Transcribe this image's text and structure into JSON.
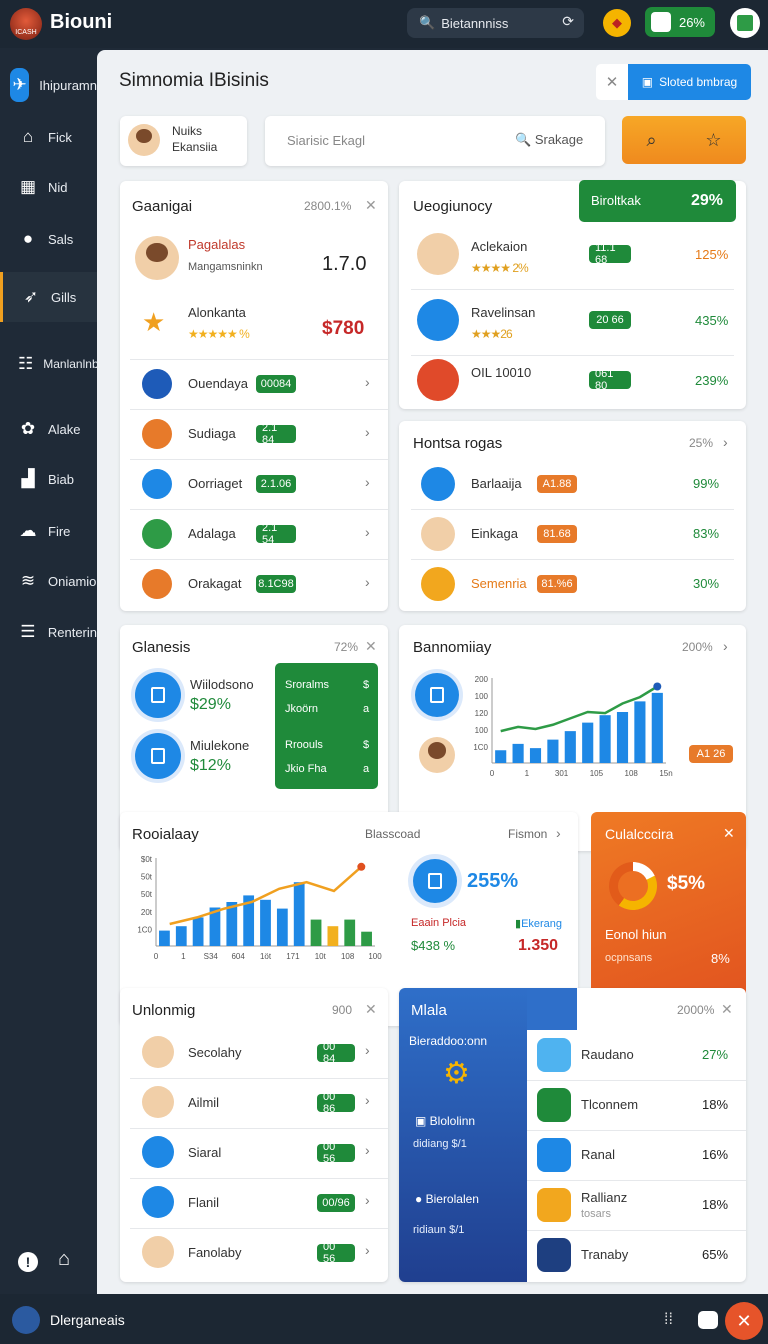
{
  "topbar": {
    "logo_text": "ICASH",
    "brand": "Biouni",
    "search_text": "Bietannniss",
    "pill_text": "26%"
  },
  "sidebar": {
    "items": [
      {
        "label": "Ihipuramn",
        "icon": "plane-icon"
      },
      {
        "label": "Fick",
        "icon": "home-icon"
      },
      {
        "label": "Nid",
        "icon": "building-icon"
      },
      {
        "label": "Sals",
        "icon": "pin-icon"
      },
      {
        "label": "Gills",
        "icon": "bird-icon"
      },
      {
        "label": "Manlanlnb",
        "icon": "table-icon"
      },
      {
        "label": "Alake",
        "icon": "puzzle-icon"
      },
      {
        "label": "Biab",
        "icon": "chart-icon"
      },
      {
        "label": "Fire",
        "icon": "chat-icon"
      },
      {
        "label": "Oniamio",
        "icon": "wifi-icon"
      },
      {
        "label": "Renterin",
        "icon": "list-icon"
      }
    ]
  },
  "bottombar": {
    "label": "Dlerganeais"
  },
  "header": {
    "title": "Simnomia IBisinis",
    "close": "✕",
    "primary_button": "Sloted bmbrag"
  },
  "profile": {
    "name": "Nuiks",
    "sub": "Ekansiia"
  },
  "search": {
    "placeholder": "Siarisic Ekagl",
    "button_label": "Srakage"
  },
  "card_a": {
    "title": "Gaanigai",
    "meta": "2800.1%",
    "top": [
      {
        "name": "Pagalalas",
        "sub": "Mangamsninkn",
        "value": "1.7.0"
      },
      {
        "name": "Alonkanta",
        "sub": "★★★★★ %",
        "value": "$780"
      }
    ],
    "rows": [
      {
        "label": "Ouendaya",
        "badge": "00084"
      },
      {
        "label": "Sudiaga",
        "badge": "2.1 84"
      },
      {
        "label": "Oorriaget",
        "badge": "2.1.06"
      },
      {
        "label": "Adalaga",
        "badge": "2.1 54"
      },
      {
        "label": "Orakagat",
        "badge": "8.1C98"
      }
    ]
  },
  "card_b": {
    "title": "Ueogiunocy",
    "green_label": "Biroltkak",
    "green_pct": "29%",
    "rows": [
      {
        "name": "Aclekaion",
        "sub": "★★★★ 2%",
        "badge": "11.1 68",
        "pct": "125%"
      },
      {
        "name": "Ravelinsan",
        "sub": "★★★26",
        "badge": "20 66",
        "pct": "435%"
      },
      {
        "name": "OIL 10010",
        "sub": "",
        "badge": "061 80",
        "pct": "239%"
      }
    ]
  },
  "card_c": {
    "title": "Hontsa rogas",
    "meta": "25%",
    "rows": [
      {
        "name": "Barlaaija",
        "badge": "A1.88",
        "pct": "99%"
      },
      {
        "name": "Einkaga",
        "badge": "81.68",
        "pct": "83%"
      },
      {
        "name": "Semenria",
        "badge": "81.%6",
        "pct": "30%"
      }
    ]
  },
  "card_d": {
    "title": "Glanesis",
    "meta": "72%",
    "items": [
      {
        "name": "Wiilodsono",
        "value": "$29%"
      },
      {
        "name": "Miulekone",
        "value": "$12%"
      }
    ],
    "panel": [
      {
        "label": "Sroralms",
        "value": "$"
      },
      {
        "label": "Jkoörn",
        "value": "a"
      },
      {
        "label": "Rroouls",
        "value": "$"
      },
      {
        "label": "Jkio Fha",
        "value": "a"
      }
    ]
  },
  "card_e": {
    "title": "Bannomiiay",
    "meta": "200%",
    "badge": "A1 26"
  },
  "card_f": {
    "title": "Rooialaay",
    "center_label": "Blasscoad",
    "right_label": "Fismon",
    "stat_big": "255%",
    "left_stat_label": "Eaain Plcia",
    "left_stat_value": "$438 %",
    "right_stat_label": "Ekerang",
    "right_stat_value": "1.350"
  },
  "card_g": {
    "title": "Culalcccira",
    "pct": "$5%",
    "label": "Eonol hiun",
    "sub": "ocpnsans",
    "sub_pct": "8%"
  },
  "card_h": {
    "title": "Unlonmig",
    "meta": "900",
    "rows": [
      {
        "label": "Secolahy",
        "badge": "00 84"
      },
      {
        "label": "Ailmil",
        "badge": "00 86"
      },
      {
        "label": "Siaral",
        "badge": "00 56"
      },
      {
        "label": "Flanil",
        "badge": "00/96"
      },
      {
        "label": "Fanolaby",
        "badge": "00 56"
      }
    ]
  },
  "card_i": {
    "title": "Mlala",
    "meta": "2000%",
    "subtitle": "Bieraddoo:onn",
    "items": [
      {
        "name": "Blololinn",
        "sub": "didiang $/1"
      },
      {
        "name": "Bierolalen",
        "sub": "ridiaun $/1"
      }
    ],
    "rows": [
      {
        "label": "Raudano",
        "pct": "27%"
      },
      {
        "label": "Tlconnem",
        "pct": "18%"
      },
      {
        "label": "Ranal",
        "pct": "16%"
      },
      {
        "label": "Rallianz",
        "sub": "tosars",
        "pct": "18%"
      },
      {
        "label": "Tranaby",
        "pct": "65%"
      }
    ]
  },
  "chart_data": [
    {
      "type": "bar",
      "title": "",
      "ytick_labels": [
        "200",
        "100",
        "120",
        "100",
        "1C0"
      ],
      "xtick_labels": [
        "0",
        "1",
        "301",
        "105",
        "108",
        "15n"
      ],
      "values": [
        12,
        18,
        14,
        22,
        30,
        38,
        45,
        48,
        58,
        66
      ],
      "line": [
        30,
        34,
        32,
        36,
        42,
        48,
        47,
        56,
        62,
        72
      ],
      "ylim": [
        0,
        80
      ]
    },
    {
      "type": "bar",
      "title": "",
      "ytick_labels": [
        "$0t",
        "50t",
        "50t",
        "20t",
        "1C0"
      ],
      "xtick_labels": [
        "0",
        "1",
        "S34",
        "604",
        "1öt",
        "171",
        "10t",
        "108",
        "100"
      ],
      "values": [
        14,
        18,
        26,
        35,
        40,
        46,
        42,
        34,
        58,
        24,
        18,
        24,
        13
      ],
      "line": [
        20,
        26,
        34,
        40,
        52,
        58,
        50,
        72
      ],
      "ylim": [
        0,
        80
      ]
    }
  ]
}
